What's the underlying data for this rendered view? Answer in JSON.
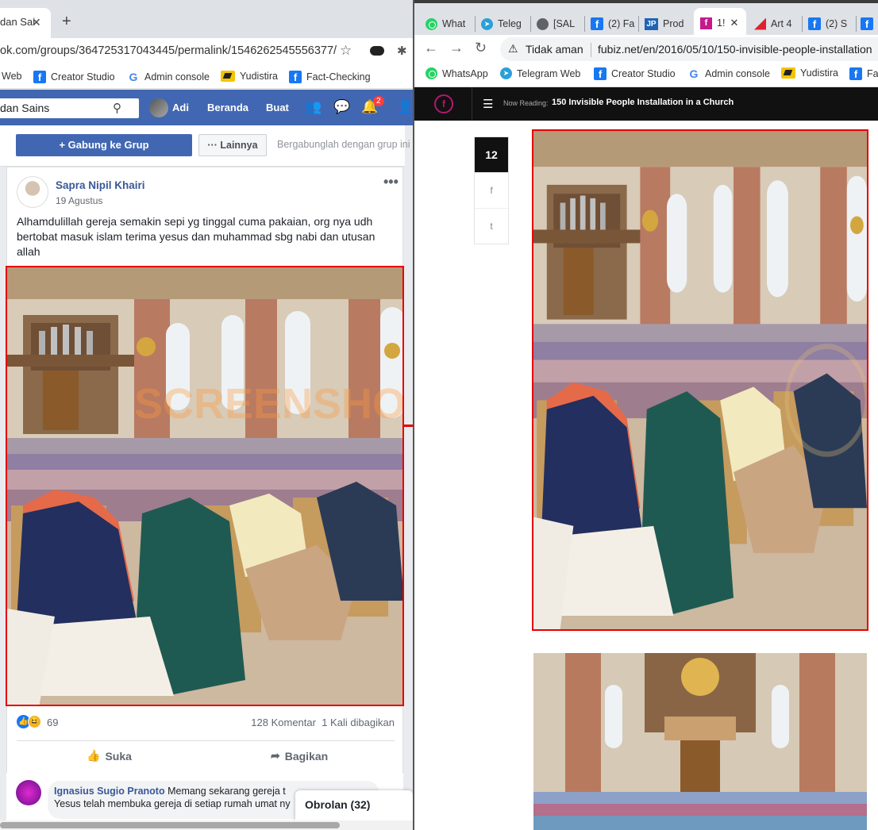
{
  "left": {
    "tab": {
      "title": "dan Sai",
      "close": "✕",
      "new": "+"
    },
    "address": {
      "url": "ok.com/groups/364725317043445/permalink/1546262545556377/"
    },
    "bookmarks": [
      "Web",
      "Creator Studio",
      "Admin console",
      "Yudistira",
      "Fact-Checking"
    ],
    "fbnav": {
      "search_value": "dan Sains",
      "user": "Adi",
      "home": "Beranda",
      "create": "Buat",
      "notif_count": "2"
    },
    "group": {
      "join": "+ Gabung ke Grup",
      "more": "··· Lainnya",
      "hint": "Bergabunglah dengan grup ini u"
    },
    "post": {
      "author": "Sapra Nipil Khairi",
      "date": "19 Agustus",
      "text": "Alhamdulillah gereja semakin sepi yg tinggal cuma pakaian, org nya udh bertobat masuk islam terima yesus dan muhammad sbg nabi dan utusan allah",
      "reactions": "69",
      "comments": "128 Komentar",
      "shares": "1 Kali dibagikan",
      "like": "Suka",
      "share": "Bagikan",
      "watermark": "SCREENSHOT"
    },
    "comment": {
      "name": "Ignasius Sugio Pranoto",
      "text1": "Memang sekarang gereja t",
      "text2": "Yesus telah membuka gereja di setiap rumah umat ny"
    },
    "chat": "Obrolan (32)"
  },
  "right": {
    "tabs": [
      "What",
      "Teleg",
      "[SAL",
      "(2) Fa",
      "Prod",
      "1!",
      "Art 4",
      "(2) S"
    ],
    "address": {
      "insecure": "Tidak aman",
      "url": "fubiz.net/en/2016/05/10/150-invisible-people-installation"
    },
    "bookmarks": [
      "WhatsApp",
      "Telegram Web",
      "Creator Studio",
      "Admin console",
      "Yudistira",
      "Fac"
    ],
    "site": {
      "logo": "f",
      "now_label": "Now Reading:",
      "now_title": "150 Invisible People Installation in a Church"
    },
    "share": {
      "count": "12",
      "fb": "f",
      "tw": "t"
    }
  },
  "colors": {
    "fb_blue": "#4267b2",
    "highlight_red": "#e60000",
    "fubiz_dark": "#111111"
  }
}
